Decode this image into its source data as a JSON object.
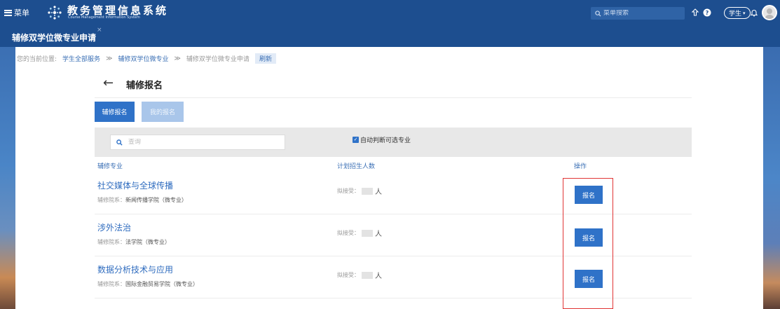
{
  "topbar": {
    "menu_label": "菜单",
    "system_title": "教务管理信息系统",
    "system_subtitle": "Course Management Information System",
    "search_placeholder": "菜单搜索",
    "role_label": "学生",
    "icons": [
      "menu-icon",
      "logo-icon",
      "search-icon",
      "share-icon",
      "help-icon",
      "role-dropdown-icon",
      "bell-icon",
      "avatar"
    ]
  },
  "tabs": {
    "active_label": "辅修双学位微专业申请",
    "close_glyph": "×"
  },
  "breadcrumb": {
    "prefix": "您的当前位置:",
    "items": [
      "学生全部服务",
      "辅修双学位微专业",
      "辅修双学位微专业申请"
    ],
    "separator": "≫",
    "refresh": "刷新"
  },
  "page": {
    "back_glyph": "←",
    "title": "辅修报名"
  },
  "actions": {
    "apply_label": "辅修报名",
    "my_apply_label": "我的报名"
  },
  "filter": {
    "search_placeholder": "查询",
    "auto_check_label": "自动判断可选专业",
    "auto_check_checked": true
  },
  "table": {
    "columns": [
      "辅修专业",
      "计划招生人数",
      "操作"
    ],
    "dept_label": "辅修院系：",
    "plan_label": "拟接受：",
    "rows": [
      {
        "name": "社交媒体与全球传播",
        "dept": "新闻传播学院（微专业）",
        "plan_unit": "人",
        "action": "报名"
      },
      {
        "name": "涉外法治",
        "dept": "法学院（微专业）",
        "plan_unit": "人",
        "action": "报名"
      },
      {
        "name": "数据分析技术与应用",
        "dept": "国际金融贸易学院（微专业）",
        "plan_unit": "人",
        "action": "报名"
      }
    ]
  },
  "colors": {
    "topbar": "#1d4e8f",
    "primary": "#2f72c8",
    "link": "#2f6cbf",
    "highlight": "#e03434"
  }
}
